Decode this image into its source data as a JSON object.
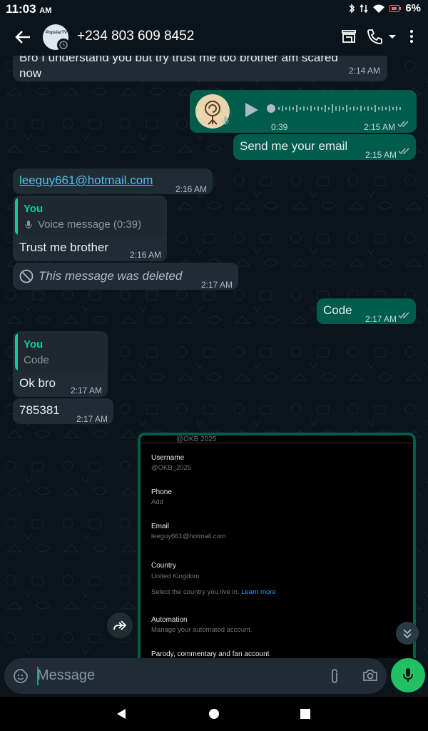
{
  "status_bar": {
    "time": "11:03",
    "ampm": "AM",
    "battery": "6%"
  },
  "header": {
    "contact": "+234 803 609 8452",
    "avatar_text": "PopularTV"
  },
  "messages": {
    "m1_text": "Bro I understand you but try trust me too  brother am scared now",
    "m1_time": "2:14 AM",
    "voice_duration": "0:39",
    "voice_time": "2:15 AM",
    "m3_text": "Send me your email",
    "m3_time": "2:15 AM",
    "m4_text": "leeguy661@hotmail.com",
    "m4_time": "2:16 AM",
    "m5_quote_author": "You",
    "m5_quote_text": "Voice message (0:39)",
    "m5_text": "Trust me brother",
    "m5_time": "2:16 AM",
    "m6_text": "This message was deleted",
    "m6_time": "2:17 AM",
    "m7_text": "Code",
    "m7_time": "2:17 AM",
    "m8_quote_author": "You",
    "m8_quote_text": "Code",
    "m8_text": "Ok bro",
    "m8_time": "2:17 AM",
    "m9_text": "785381",
    "m9_time": "2:17 AM"
  },
  "screenshot": {
    "top_handle": "@OKB 2025",
    "username_label": "Username",
    "username_value": "@OKB_2025",
    "phone_label": "Phone",
    "phone_value": "Add",
    "email_label": "Email",
    "email_value": "leeguy661@hotmail.com",
    "country_label": "Country",
    "country_value": "United Kingdom",
    "country_hint": "Select the country you live in.",
    "learn_more": "Learn more",
    "automation_label": "Automation",
    "automation_value": "Manage your automated account.",
    "parody_label": "Parody, commentary and fan account"
  },
  "input": {
    "placeholder": "Message"
  },
  "colors": {
    "incoming": "#202c33",
    "outgoing": "#005c4b",
    "accent": "#06cf9c",
    "mic": "#21c063"
  }
}
